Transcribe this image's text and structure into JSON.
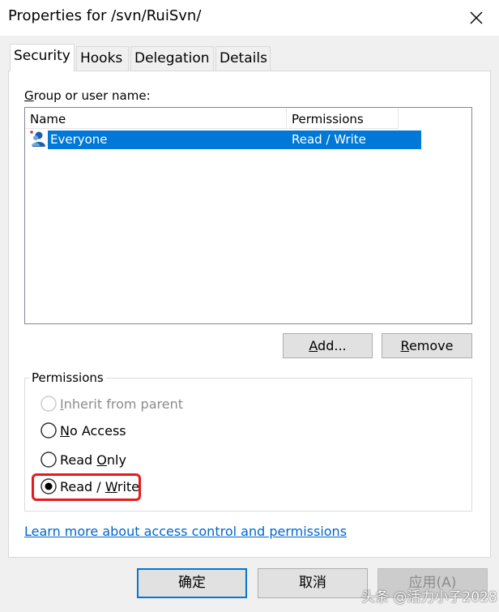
{
  "window": {
    "title": "Properties for /svn/RuiSvn/"
  },
  "tabs": [
    {
      "label": "Security",
      "active": true
    },
    {
      "label": "Hooks",
      "active": false
    },
    {
      "label": "Delegation",
      "active": false
    },
    {
      "label": "Details",
      "active": false
    }
  ],
  "security": {
    "group_label_prefix": "G",
    "group_label_rest": "roup or user name:",
    "columns": {
      "name": "Name",
      "permissions": "Permissions"
    },
    "rows": [
      {
        "name": "Everyone",
        "permission": "Read / Write",
        "selected": true,
        "icon": "user-group-icon"
      }
    ],
    "add_button": {
      "prefix": "A",
      "rest": "dd..."
    },
    "remove_button": {
      "prefix": "R",
      "rest": "emove"
    },
    "permissions_group": "Permissions",
    "options": {
      "inherit": {
        "prefix": "I",
        "rest": "nherit from parent",
        "enabled": false,
        "checked": false
      },
      "no_access": {
        "prefix": "N",
        "rest": "o Access",
        "checked": false
      },
      "read_only": {
        "prefix": "Read ",
        "u": "O",
        "rest": "nly",
        "checked": false
      },
      "read_write": {
        "prefix": "Read / ",
        "u": "W",
        "rest": "rite",
        "checked": true
      }
    },
    "learn_more_link": "Learn more about access control and permissions"
  },
  "buttons": {
    "ok": "确定",
    "cancel": "取消",
    "apply": "应用(A)"
  },
  "watermark": "头条 @活力小子2028",
  "colors": {
    "selection": "#0078d7",
    "link": "#0066cc",
    "highlight": "#e8191b"
  }
}
